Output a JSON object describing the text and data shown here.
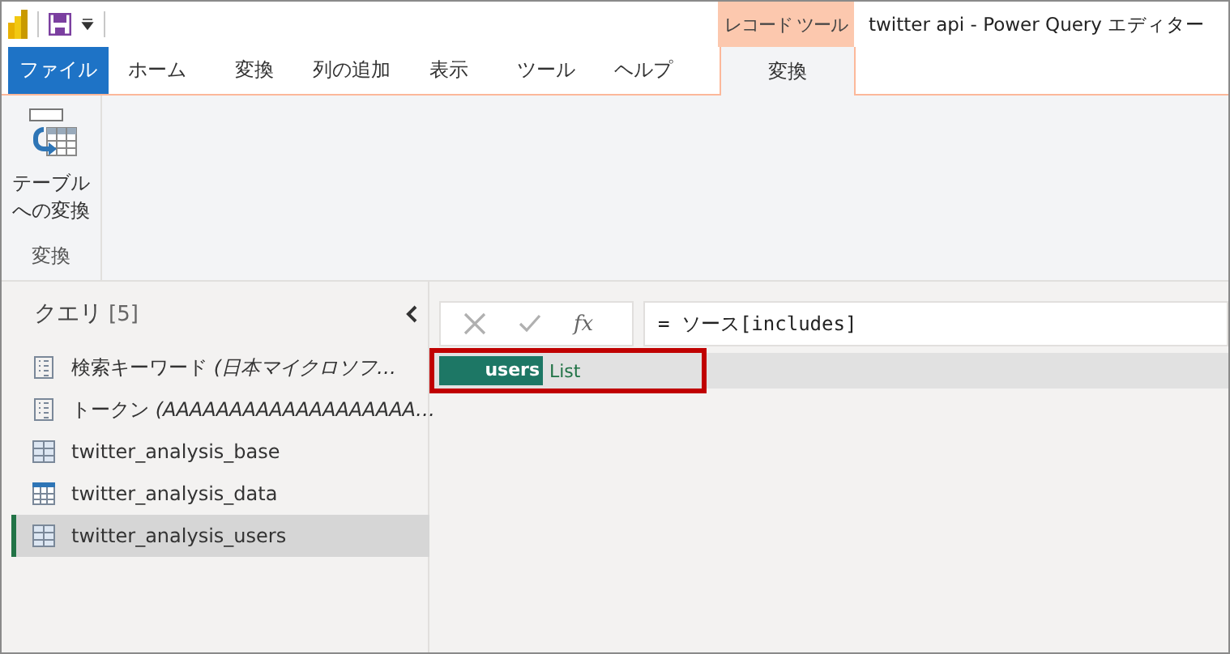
{
  "window": {
    "title": "twitter api - Power Query エディター"
  },
  "context_tab_group": "レコード ツール",
  "tabs": [
    {
      "label": "ファイル",
      "kind": "file",
      "selected": false
    },
    {
      "label": "ホーム",
      "kind": "normal",
      "selected": false
    },
    {
      "label": "変換",
      "kind": "normal",
      "selected": false
    },
    {
      "label": "列の追加",
      "kind": "normal",
      "selected": false
    },
    {
      "label": "表示",
      "kind": "normal",
      "selected": false
    },
    {
      "label": "ツール",
      "kind": "normal",
      "selected": false
    },
    {
      "label": "ヘルプ",
      "kind": "normal",
      "selected": false
    },
    {
      "label": "変換",
      "kind": "context",
      "selected": true
    }
  ],
  "ribbon": {
    "groups": [
      {
        "label": "変換",
        "buttons": [
          {
            "lines": [
              "テーブル",
              "への変換"
            ]
          }
        ]
      }
    ]
  },
  "queries": {
    "title": "クエリ",
    "count": "[5]",
    "items": [
      {
        "label": "検索キーワード *(日本マイクロソフ…*",
        "kind": "parameter",
        "selected": false
      },
      {
        "label": "トークン *(AAAAAAAAAAAAAAAAAAA…*",
        "kind": "parameter",
        "selected": false
      },
      {
        "label": "twitter_analysis_base",
        "kind": "table",
        "selected": false
      },
      {
        "label": "twitter_analysis_data",
        "kind": "grid",
        "selected": false
      },
      {
        "label": "twitter_analysis_users",
        "kind": "table",
        "selected": true
      }
    ]
  },
  "formula_bar": {
    "function_label": "fx",
    "formula": "= ソース[includes]"
  },
  "record": {
    "fields": [
      {
        "name": "users",
        "value": "List",
        "highlighted": true
      }
    ]
  }
}
